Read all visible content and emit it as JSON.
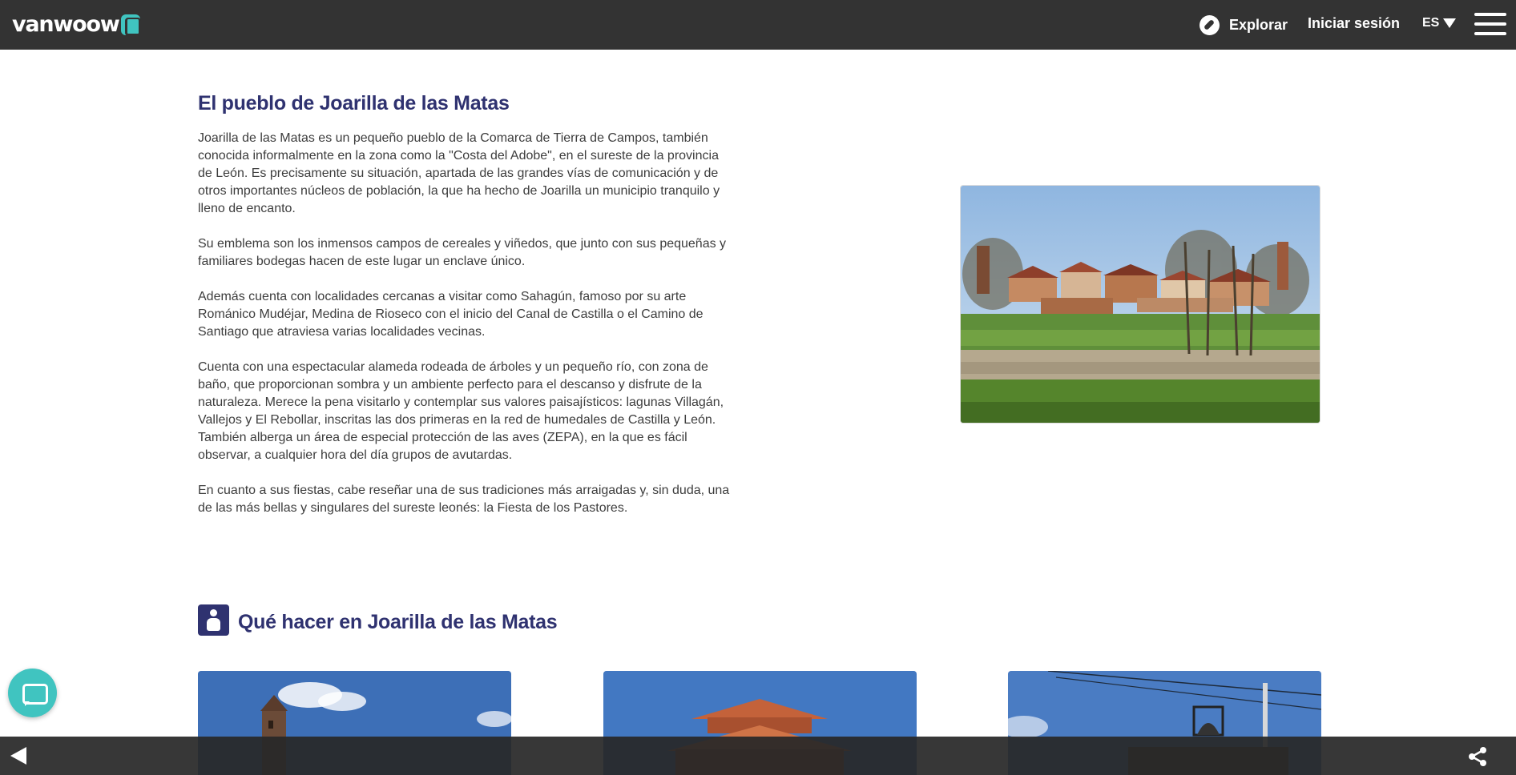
{
  "header": {
    "logo_text": "vanwoow",
    "explore_label": "Explorar",
    "login_label": "Iniciar sesión",
    "language": "ES"
  },
  "article": {
    "title": "El pueblo de Joarilla de las Matas",
    "paragraphs": [
      "Joarilla de las Matas es un pequeño pueblo de la Comarca de Tierra de Campos, también conocida informalmente en la zona como la \"Costa del Adobe\", en el sureste de la provincia de León. Es precisamente su situación, apartada de las grandes vías de comunicación y de otros importantes núcleos de población, la que ha hecho de Joarilla un municipio tranquilo y lleno de encanto.",
      "Su emblema son los inmensos campos de cereales y viñedos, que junto con sus pequeñas y familiares bodegas hacen de este lugar un enclave único.",
      "Además cuenta con localidades cercanas a visitar como Sahagún, famoso por su arte Románico Mudéjar, Medina de Rioseco con el inicio del Canal de Castilla o el Camino de Santiago que atraviesa varias localidades vecinas.",
      "Cuenta con una espectacular alameda rodeada de árboles y un pequeño río, con zona de baño, que proporcionan sombra y un ambiente perfecto para el descanso y disfrute de la naturaleza. Merece la pena visitarlo y contemplar sus valores paisajísticos: lagunas Villagán, Vallejos y El Rebollar, inscritas las dos primeras en la red de humedales de Castilla y León. También alberga un área de especial protección de las aves (ZEPA), en la que es fácil observar, a cualquier hora del día grupos de avutardas.",
      "En cuanto a sus fiestas, cabe reseñar una de sus tradiciones más arraigadas y, sin duda, una de las más bellas y singulares del sureste leonés: la Fiesta de los Pastores."
    ]
  },
  "todo": {
    "title": "Qué hacer en Joarilla de las Matas"
  },
  "colors": {
    "accent_navy": "#2f3270",
    "accent_teal": "#40c4c0",
    "topbar": "#333333"
  },
  "icons": [
    "compass-icon",
    "caret-down-icon",
    "menu-icon",
    "activity-icon",
    "chat-icon",
    "back-arrow-icon",
    "share-icon"
  ]
}
